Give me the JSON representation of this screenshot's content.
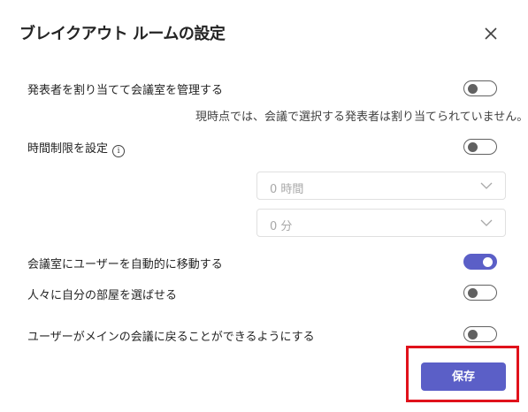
{
  "dialog": {
    "title": "ブレイクアウト ルームの設定",
    "close_icon": "close-icon"
  },
  "settings": {
    "assign_presenters": {
      "label": "発表者を割り当てて会議室を管理する",
      "description": "現時点では、会議で選択する発表者は割り当てられていません。",
      "enabled": false
    },
    "time_limit": {
      "label": "時間制限を設定",
      "info_icon": "info-icon",
      "enabled": false,
      "hours_value": "0 時間",
      "minutes_value": "0 分"
    },
    "auto_move": {
      "label": "会議室にユーザーを自動的に移動する",
      "enabled": true
    },
    "choose_room": {
      "label": "人々に自分の部屋を選ばせる",
      "enabled": false
    },
    "return_main": {
      "label": "ユーザーがメインの会議に戻ることができるようにする",
      "enabled": false
    }
  },
  "footer": {
    "save_label": "保存"
  },
  "colors": {
    "accent": "#5b5fc7",
    "highlight": "#e0121b"
  }
}
